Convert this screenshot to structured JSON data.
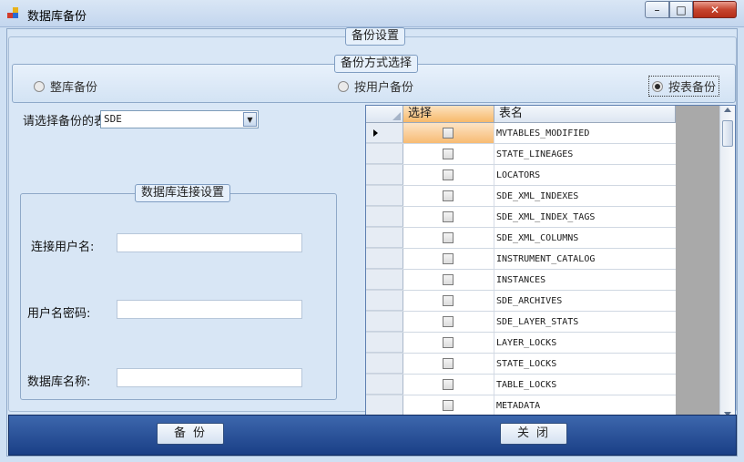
{
  "window": {
    "title": "数据库备份",
    "minimize_glyph": "–",
    "maximize_glyph": "□",
    "close_glyph": "✕"
  },
  "backup_settings": {
    "label": "备份设置",
    "method": {
      "label": "备份方式选择",
      "options": [
        {
          "label": "整库备份",
          "checked": false
        },
        {
          "label": "按用户备份",
          "checked": false
        },
        {
          "label": "按表备份",
          "checked": true
        }
      ]
    },
    "table_select": {
      "label": "请选择备份的表",
      "value": "SDE"
    },
    "connection": {
      "label": "数据库连接设置",
      "username_label": "连接用户名:",
      "password_label": "用户名密码:",
      "dbname_label": "数据库名称:",
      "username_value": "",
      "password_value": "",
      "dbname_value": ""
    }
  },
  "grid": {
    "columns": [
      "选择",
      "表名"
    ],
    "rows": [
      {
        "checked": false,
        "name": "MVTABLES_MODIFIED",
        "current": true
      },
      {
        "checked": false,
        "name": "STATE_LINEAGES"
      },
      {
        "checked": false,
        "name": "LOCATORS"
      },
      {
        "checked": false,
        "name": "SDE_XML_INDEXES"
      },
      {
        "checked": false,
        "name": "SDE_XML_INDEX_TAGS"
      },
      {
        "checked": false,
        "name": "SDE_XML_COLUMNS"
      },
      {
        "checked": false,
        "name": "INSTRUMENT_CATALOG"
      },
      {
        "checked": false,
        "name": "INSTANCES"
      },
      {
        "checked": false,
        "name": "SDE_ARCHIVES"
      },
      {
        "checked": false,
        "name": "SDE_LAYER_STATS"
      },
      {
        "checked": false,
        "name": "LAYER_LOCKS"
      },
      {
        "checked": false,
        "name": "STATE_LOCKS"
      },
      {
        "checked": false,
        "name": "TABLE_LOCKS"
      },
      {
        "checked": false,
        "name": "METADATA"
      }
    ]
  },
  "buttons": {
    "backup": "备份",
    "close": "关闭"
  }
}
